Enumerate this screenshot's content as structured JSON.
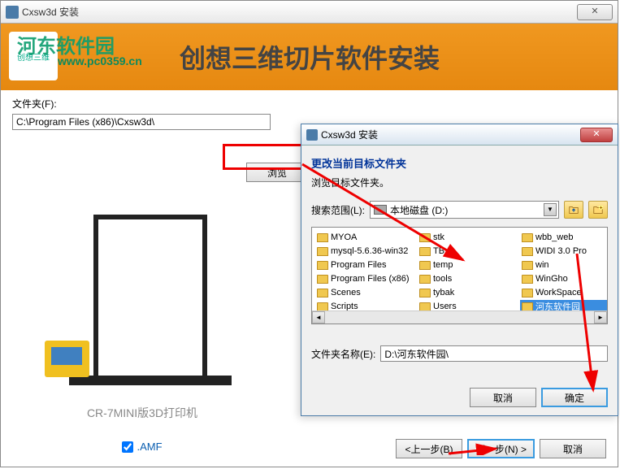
{
  "main_window": {
    "title": "Cxsw3d 安装",
    "close_label": "✕",
    "banner_title": "创想三维切片软件安装",
    "watermark": "河东软件园",
    "watermark_url": "www.pc0359.cn",
    "folder_label": "文件夹(F):",
    "folder_value": "C:\\Program Files (x86)\\Cxsw3d\\",
    "browse_label": "浏览",
    "printer_caption": "CR-7MINI版3D打印机",
    "amf_label": ".AMF",
    "back_label": "<上一步(B)",
    "next_label": "下一步(N) >",
    "cancel_label": "取消"
  },
  "dialog": {
    "title": "Cxsw3d 安装",
    "heading": "更改当前目标文件夹",
    "sub": "浏览目标文件夹。",
    "search_label": "搜索范围(L):",
    "drive_label": "本地磁盘 (D:)",
    "filename_label": "文件夹名称(E):",
    "filename_value": "D:\\河东软件园\\",
    "ok_label": "确定",
    "cancel_label": "取消"
  },
  "folder_items": [
    {
      "name": "MYOA"
    },
    {
      "name": "mysql-5.6.36-win32"
    },
    {
      "name": "Program Files"
    },
    {
      "name": "Program Files (x86)"
    },
    {
      "name": "Scenes"
    },
    {
      "name": "Scripts"
    },
    {
      "name": "stk"
    },
    {
      "name": "TB"
    },
    {
      "name": "temp"
    },
    {
      "name": "tools"
    },
    {
      "name": "tybak"
    },
    {
      "name": "Users"
    },
    {
      "name": "wbb_web"
    },
    {
      "name": "WIDI 3.0 Pro"
    },
    {
      "name": "win"
    },
    {
      "name": "WinGho"
    },
    {
      "name": "WorkSpace"
    },
    {
      "name": "河东软件园",
      "selected": true
    }
  ]
}
